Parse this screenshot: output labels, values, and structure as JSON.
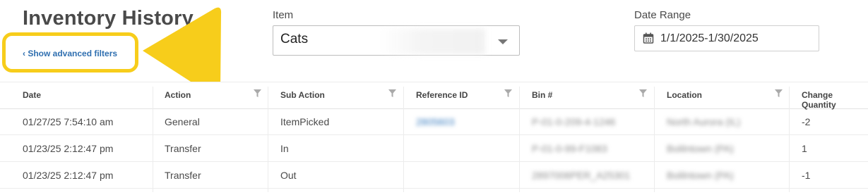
{
  "header": {
    "title": "Inventory History",
    "advanced_filters_link": "‹ Show advanced filters"
  },
  "filters": {
    "item_label": "Item",
    "item_value": "Cats",
    "date_range_label": "Date Range",
    "date_range_value": "1/1/2025-1/30/2025"
  },
  "table": {
    "columns": [
      "Date",
      "Action",
      "Sub Action",
      "Reference ID",
      "Bin #",
      "Location",
      "Change Quantity"
    ],
    "rows": [
      {
        "date": "01/27/25 7:54:10 am",
        "action": "General",
        "sub_action": "ItemPicked",
        "reference_id": "2805603",
        "bin": "P-01-0-209-4-1246",
        "location": "North Aurora (IL)",
        "change_quantity": "-2"
      },
      {
        "date": "01/23/25 2:12:47 pm",
        "action": "Transfer",
        "sub_action": "In",
        "reference_id": "",
        "bin": "P-01-0-99-F1083",
        "location": "Bolilntown (PA)",
        "change_quantity": "1"
      },
      {
        "date": "01/23/25 2:12:47 pm",
        "action": "Transfer",
        "sub_action": "Out",
        "reference_id": "",
        "bin": "2897006PER_A25301",
        "location": "Bolilntown (PA)",
        "change_quantity": "-1"
      }
    ]
  },
  "colors": {
    "highlight": "#f7cd1b",
    "link": "#2f6fb0"
  },
  "icons": {
    "calendar": "calendar-icon",
    "filter": "filter-icon",
    "dropdown": "chevron-down-icon",
    "callout": "arrow-callout"
  }
}
